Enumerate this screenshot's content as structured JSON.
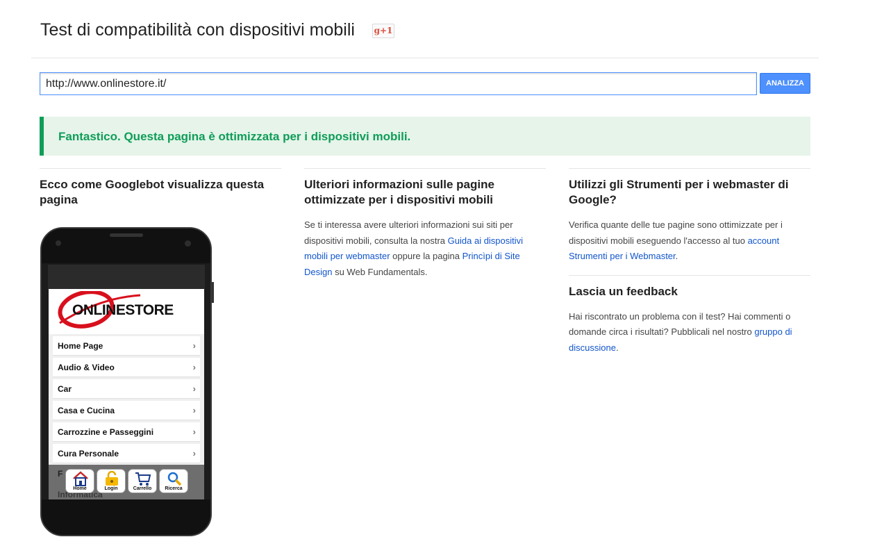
{
  "header": {
    "title": "Test di compatibilità con dispositivi mobili",
    "gplus_label": "g+1"
  },
  "search": {
    "url_value": "http://www.onlinestore.it/",
    "analyze_label": "ANALIZZA"
  },
  "result": {
    "message": "Fantastico. Questa pagina è ottimizzata per i dispositivi mobili."
  },
  "col1": {
    "title": "Ecco come Googlebot visualizza questa pagina"
  },
  "phone": {
    "logo_text": "ONLINESTORE",
    "menu_items": [
      "Home Page",
      "Audio & Video",
      "Car",
      "Casa e Cucina",
      "Carrozzine e Passeggini",
      "Cura Personale"
    ],
    "ghost_f": "F",
    "ghost_text": "Informatica",
    "tabs": [
      "Home",
      "Login",
      "Carrello",
      "Ricerca"
    ]
  },
  "col2": {
    "title": "Ulteriori informazioni sulle pagine ottimizzate per i dispositivi mobili",
    "text_1": "Se ti interessa avere ulteriori informazioni sui siti per dispositivi mobili, consulta la nostra ",
    "link_1": "Guida ai dispositivi mobili per webmaster",
    "text_2": " oppure la pagina ",
    "link_2": "Princìpi di Site Design",
    "text_3": " su Web Fundamentals."
  },
  "col3": {
    "title": "Utilizzi gli Strumenti per i webmaster di Google?",
    "text_1": "Verifica quante delle tue pagine sono ottimizzate per i dispositivi mobili eseguendo l'accesso al tuo ",
    "link_1": "account Strumenti per i Webmaster",
    "text_2": ".",
    "feedback_title": "Lascia un feedback",
    "feedback_text": "Hai riscontrato un problema con il test? Hai commenti o domande circa i risultati? Pubblicali nel nostro ",
    "feedback_link": "gruppo di discussione",
    "feedback_end": "."
  },
  "colors": {
    "accent": "#4d90fe",
    "success": "#0f9d58",
    "link": "#1155cc",
    "logo_red": "#d8101d"
  }
}
